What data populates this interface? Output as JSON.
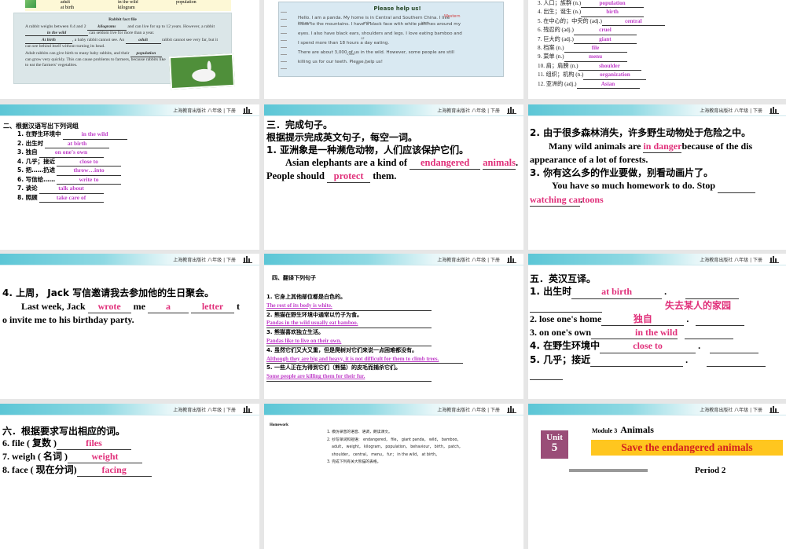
{
  "header": {
    "publisher": "上海教育出版社 八年级 | 下册"
  },
  "slide1": {
    "word_box": {
      "row1": [
        "adult",
        "in the wild",
        "population"
      ],
      "row2": [
        "at birth",
        "kilogram"
      ]
    },
    "title": "Rabbit fact file",
    "p1a": "A rabbit weighs between 0.4 and 2",
    "a1": "kilograms",
    "p1b": "and can live for up to 12 years. However, a rabbit",
    "a2": "in the wild",
    "p1c": "can seldom live for more than a year.",
    "a3": "At birth",
    "p2a": ", a baby rabbit cannot see. An",
    "a4": "adult",
    "p2b": "rabbit cannot see very far, but it can see behind itself without turning its head.",
    "p3a": "Adult rabbits can give birth to many baby rabbits, and their",
    "a5": "population",
    "p3b": "can grow very quickly. This can cause problems to farmers, because rabbits like to eat the farmers' vegetables."
  },
  "slide2": {
    "title": "Please help us!",
    "l1": "Hello. I am a panda. My home is in Central and Southern China. I live",
    "c1": "Western",
    "c2": "high up in",
    "c3": "white",
    "c4": "black",
    "c5": "12",
    "c6": "1,600",
    "c7": "for",
    "c8": "fur",
    "l2": "close to the mountains. I have a black face with white patches around my",
    "l3": "eyes. I also have black ears, shoulders and legs. I love eating bamboo and",
    "l4": "I spend more than 18 hours a day eating.",
    "l5": "There are about 3,000 of us in the wild. However, some people are still",
    "l6": "killing us for our teeth. Please help us!"
  },
  "slide3": {
    "items": [
      {
        "q": "3. 人口；族群 (n.)",
        "a": "population"
      },
      {
        "q": "4. 出生；诞生 (n.)",
        "a": "birth"
      },
      {
        "q": "5. 在中心的；中央的 (adj.)",
        "a": "central"
      },
      {
        "q": "6. 残忍的 (adj.)",
        "a": "cruel"
      },
      {
        "q": "7. 巨大的 (adj.)",
        "a": "giant"
      },
      {
        "q": "8. 档案 (n.)",
        "a": "file"
      },
      {
        "q": "9. 菜单 (n.)",
        "a": "menu"
      },
      {
        "q": "10. 肩；肩膀 (n.)",
        "a": "shoulder"
      },
      {
        "q": "11. 组织；机构 (n.)",
        "a": "organization"
      },
      {
        "q": "12. 亚洲的 (adj.)",
        "a": "Asian"
      }
    ]
  },
  "slide4": {
    "title": "二、根据汉语写出下列词组",
    "items": [
      {
        "q": "1. 在野生环境中",
        "a": "in the wild"
      },
      {
        "q": "2. 出生时",
        "a": "at birth"
      },
      {
        "q": "3. 独自",
        "a": "on one's own"
      },
      {
        "q": "4. 几乎；接近",
        "a": "close to"
      },
      {
        "q": "5. 把……扔进",
        "a": "throw…into"
      },
      {
        "q": "6. 写信给……",
        "a": "write to"
      },
      {
        "q": "7. 谈论",
        "a": "talk about"
      },
      {
        "q": "8. 照顾",
        "a": "take care of"
      }
    ]
  },
  "slide5": {
    "title": "三．完成句子。",
    "subtitle": "根据提示完成英文句子，每空一词。",
    "q1": "1. 亚洲象是一种濒危动物，人们应该保护它们。",
    "s1": "Asian elephants are a kind of",
    "a1": "endangered",
    "a2": "animals",
    "s2": ". People should",
    "a3": "protect",
    "s3": "them."
  },
  "slide6": {
    "q2": "2. 由于很多森林消失，许多野生动物处于危险之中。",
    "s2a": "Many wild animals are",
    "a1": "in danger",
    "s2b": "because of the dis",
    "s2c": "appearance of a lot of forests.",
    "q3": "3. 你有这么多的作业要做，别看动画片了。",
    "s3a": "You have so much homework to do. Stop",
    "a2": "watching cartoons",
    "s3b": "."
  },
  "slide7": {
    "q4": "4. 上周， Jack 写信邀请我去参加他的生日聚会。",
    "s1": "Last week, Jack",
    "a1": "wrote",
    "s2": "me",
    "a2": "a",
    "a3": "letter",
    "s3": "t",
    "s4": "o invite me to his birthday party."
  },
  "slide8": {
    "title": "四、翻译下列句子",
    "items": [
      {
        "q": "1. 它身上其他部位都是白色的。",
        "a": "The rest of its body is white."
      },
      {
        "q": "2. 熊猫在野生环境中通常以竹子为食。",
        "a": "Pandas in the wild usually eat bamboo."
      },
      {
        "q": "3. 熊猫喜欢独立生活。",
        "a": "Pandas like to live on their own."
      },
      {
        "q": "4. 虽然它们又大又重，但是爬树对它们来说一点困难都没有。",
        "a": "Although they are big and heavy, it is not difficult for them to climb trees."
      },
      {
        "q": "5. 一些人正在为得到它们（熊猫）的皮毛而捕杀它们。",
        "a": "Some people are killing them for their fur."
      }
    ]
  },
  "slide9": {
    "title": "五．英汉互译。",
    "q1": "1. 出生时",
    "a1": "at birth",
    "a2": "失去某人的家园",
    "q2": "2. lose one's home",
    "a3": "独自",
    "q3": "3. on one's own",
    "a4": "in the wild",
    "q4": "4. 在野生环境中",
    "a5": "close to",
    "q5": "5. 几乎；接近"
  },
  "slide10": {
    "title": "六．根据要求写出相应的词。",
    "items": [
      {
        "q": "6. file ( 复数 )",
        "a": "files"
      },
      {
        "q": "7. weigh ( 名词 )",
        "a": "weight"
      },
      {
        "q": "8. face ( 现在分词)",
        "a": "facing"
      }
    ]
  },
  "slide11": {
    "label": "Homework",
    "items": [
      "1. 模仿录音的语音、语调，朗读课文。",
      "2. 抄写单词和短语： endangered， file， giant panda， wild， bamboo，",
      "adult， weight， kilogram， population， behaviour， birth， patch，",
      "shoulder， central， menu， fur； in the wild， at birth。",
      "3. 完成下列有关大熊猫的表格。"
    ]
  },
  "slide12": {
    "unit_label": "Unit",
    "unit_number": "5",
    "module": "Module 3",
    "module_name": "Animals",
    "banner": "Save the endangered animals",
    "period": "Period 2"
  },
  "colors": {
    "answer_magenta": "#c03fc9",
    "answer_pink": "#e0307a",
    "unit_purple": "#9a4d78",
    "banner_yellow": "#ffc61f",
    "banner_red": "#d41f1f"
  }
}
